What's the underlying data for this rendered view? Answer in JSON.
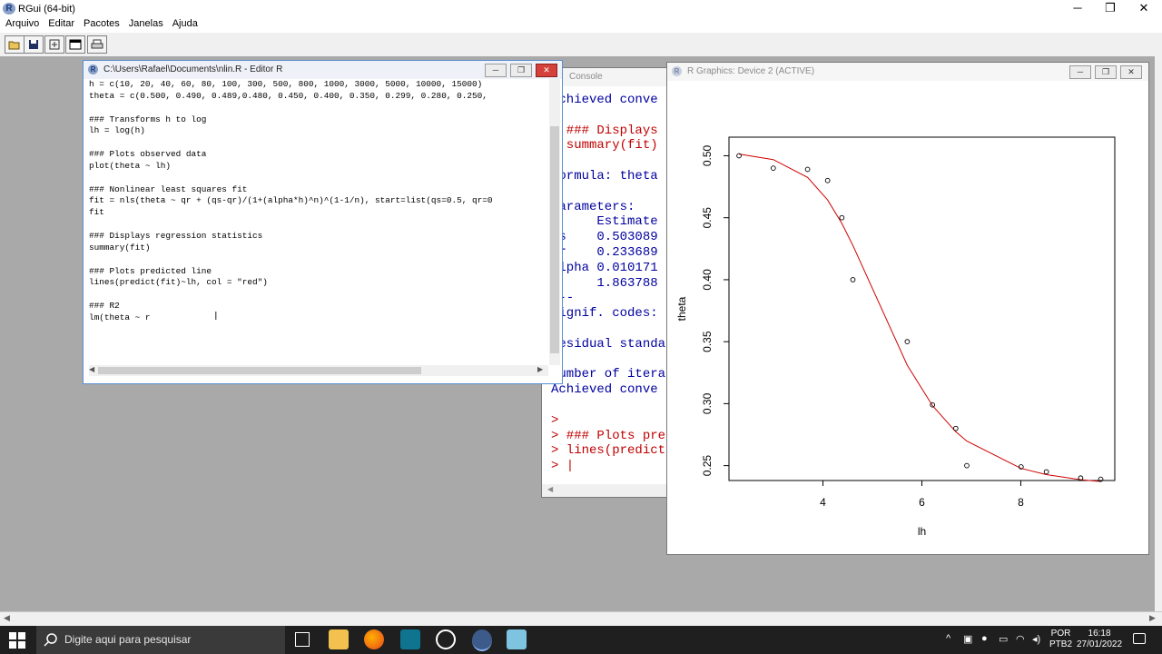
{
  "app": {
    "title": "RGui (64-bit)",
    "icon": "r-logo-icon",
    "menus": [
      "Arquivo",
      "Editar",
      "Pacotes",
      "Janelas",
      "Ajuda"
    ],
    "window_controls": {
      "minimize": "─",
      "maximize": "❐",
      "close": "✕"
    }
  },
  "editor": {
    "title": "C:\\Users\\Rafael\\Documents\\nlin.R - Editor R",
    "lines": [
      "h = c(10, 20, 40, 60, 80, 100, 300, 500, 800, 1000, 3000, 5000, 10000, 15000)",
      "theta = c(0.500, 0.490, 0.489,0.480, 0.450, 0.400, 0.350, 0.299, 0.280, 0.250,",
      "",
      "### Transforms h to log",
      "lh = log(h)",
      "",
      "### Plots observed data",
      "plot(theta ~ lh)",
      "",
      "### Nonlinear least squares fit",
      "fit = nls(theta ~ qr + (qs-qr)/(1+(alpha*h)^n)^(1-1/n), start=list(qs=0.5, qr=0",
      "fit",
      "",
      "### Displays regression statistics",
      "summary(fit)",
      "",
      "### Plots predicted line",
      "lines(predict(fit)~lh, col = \"red\")",
      "",
      "### R2",
      "lm(theta ~ r"
    ]
  },
  "console": {
    "title": "Console",
    "lines": [
      {
        "text": "Achieved conve",
        "color": "blue"
      },
      {
        "text": "",
        "color": "blue"
      },
      {
        "text": "> ### Displays",
        "color": "red"
      },
      {
        "text": "> summary(fit)",
        "color": "red"
      },
      {
        "text": "",
        "color": "blue"
      },
      {
        "text": "Formula: theta",
        "color": "blue"
      },
      {
        "text": "",
        "color": "blue"
      },
      {
        "text": "Parameters:",
        "color": "blue"
      },
      {
        "text": "      Estimate",
        "color": "blue"
      },
      {
        "text": "qs    0.503089",
        "color": "blue"
      },
      {
        "text": "qr    0.233689",
        "color": "blue"
      },
      {
        "text": "alpha 0.010171",
        "color": "blue"
      },
      {
        "text": "n     1.863788",
        "color": "blue"
      },
      {
        "text": "---",
        "color": "blue"
      },
      {
        "text": "Signif. codes:",
        "color": "blue"
      },
      {
        "text": "",
        "color": "blue"
      },
      {
        "text": "Residual standa",
        "color": "blue"
      },
      {
        "text": "",
        "color": "blue"
      },
      {
        "text": "Number of itera",
        "color": "blue"
      },
      {
        "text": "Achieved conve",
        "color": "blue"
      },
      {
        "text": "",
        "color": "blue"
      },
      {
        "text": ">",
        "color": "red"
      },
      {
        "text": "> ### Plots pre",
        "color": "red"
      },
      {
        "text": "> lines(predict",
        "color": "red"
      },
      {
        "text": "> |",
        "color": "red"
      }
    ]
  },
  "graphics": {
    "title": "R Graphics: Device 2 (ACTIVE)"
  },
  "chart_data": {
    "type": "scatter",
    "xlabel": "lh",
    "ylabel": "theta",
    "xlim": [
      2.1,
      9.9
    ],
    "ylim": [
      0.238,
      0.515
    ],
    "xticks": [
      4,
      6,
      8
    ],
    "yticks": [
      0.25,
      0.3,
      0.35,
      0.4,
      0.45,
      0.5
    ],
    "ytick_labels": [
      "0.25",
      "0.30",
      "0.35",
      "0.40",
      "0.45",
      "0.50"
    ],
    "x": [
      2.303,
      2.996,
      3.689,
      4.094,
      4.382,
      4.605,
      5.704,
      6.215,
      6.685,
      6.908,
      8.006,
      8.517,
      9.21,
      9.616
    ],
    "y": [
      0.5,
      0.49,
      0.489,
      0.48,
      0.45,
      0.4,
      0.35,
      0.299,
      0.28,
      0.25,
      0.249,
      0.245,
      0.24,
      0.239
    ],
    "fit_color": "#d00000",
    "fit_params": {
      "qs": 0.503089,
      "qr": 0.233689,
      "alpha": 0.010171,
      "n": 1.863788
    },
    "grid": false
  },
  "taskbar": {
    "search_placeholder": "Digite aqui para pesquisar",
    "lang_line1": "POR",
    "lang_line2": "PTB2",
    "time": "16:18",
    "date": "27/01/2022"
  }
}
